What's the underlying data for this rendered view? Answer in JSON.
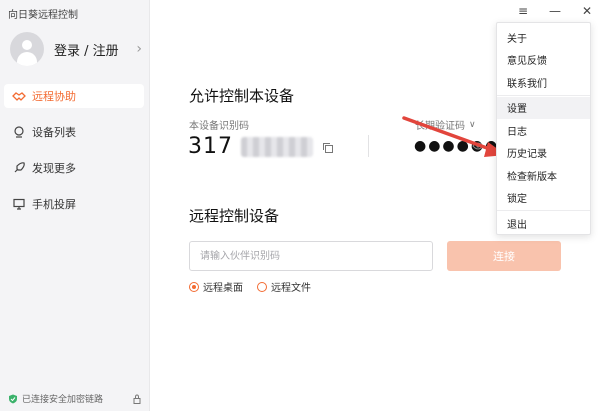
{
  "app": {
    "title": "向日葵远程控制"
  },
  "user": {
    "login_label": "登录 / 注册",
    "chevron": "›"
  },
  "nav": {
    "items": [
      {
        "label": "远程协助",
        "active": true
      },
      {
        "label": "设备列表"
      },
      {
        "label": "发现更多"
      },
      {
        "label": "手机投屏"
      }
    ]
  },
  "status": {
    "text": "已连接安全加密链路"
  },
  "window": {
    "menu_icon": "≡",
    "minimize_icon": "—",
    "close_icon": "✕"
  },
  "allow": {
    "title": "允许控制本设备",
    "id_label": "本设备识别码",
    "id_prefix": "317",
    "code_label": "长期验证码",
    "code_chevron": "∨",
    "password": "●●●●●●"
  },
  "remote": {
    "title": "远程控制设备",
    "input_placeholder": "请输入伙伴识别码",
    "connect_label": "连接",
    "options": [
      {
        "label": "远程桌面",
        "checked": true
      },
      {
        "label": "远程文件",
        "checked": false
      }
    ]
  },
  "menu": {
    "items": [
      {
        "label": "关于"
      },
      {
        "label": "意见反馈"
      },
      {
        "label": "联系我们"
      },
      {
        "label": "设置"
      },
      {
        "label": "日志"
      },
      {
        "label": "历史记录"
      },
      {
        "label": "检查新版本"
      },
      {
        "label": "锁定"
      },
      {
        "label": "退出"
      }
    ]
  },
  "colors": {
    "accent": "#f36b32",
    "connect_bg": "#f9c3ad",
    "annotation_arrow": "#e2453c",
    "status_green": "#3bb26b"
  }
}
